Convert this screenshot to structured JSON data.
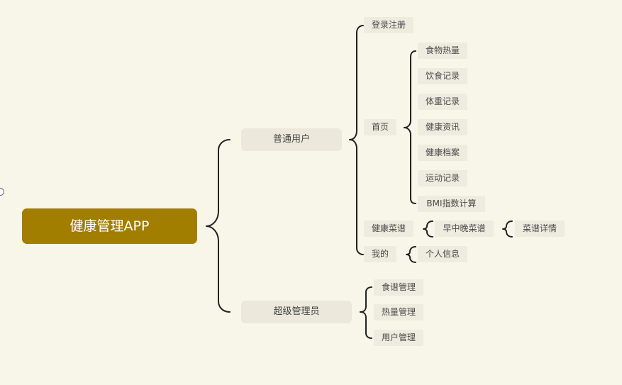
{
  "root": {
    "label": "健康管理APP"
  },
  "branches": [
    {
      "label": "普通用户",
      "children": [
        {
          "label": "登录注册"
        },
        {
          "label": "首页",
          "children": [
            {
              "label": "食物热量"
            },
            {
              "label": "饮食记录"
            },
            {
              "label": "体重记录"
            },
            {
              "label": "健康资讯"
            },
            {
              "label": "健康档案"
            },
            {
              "label": "运动记录"
            },
            {
              "label": "BMI指数计算"
            }
          ]
        },
        {
          "label": "健康菜谱",
          "children": [
            {
              "label": "早中晚菜谱",
              "children": [
                {
                  "label": "菜谱详情"
                }
              ]
            }
          ]
        },
        {
          "label": "我的",
          "children": [
            {
              "label": "个人信息"
            }
          ]
        }
      ]
    },
    {
      "label": "超级管理员",
      "children": [
        {
          "label": "食谱管理"
        },
        {
          "label": "热量管理"
        },
        {
          "label": "用户管理"
        }
      ]
    }
  ]
}
